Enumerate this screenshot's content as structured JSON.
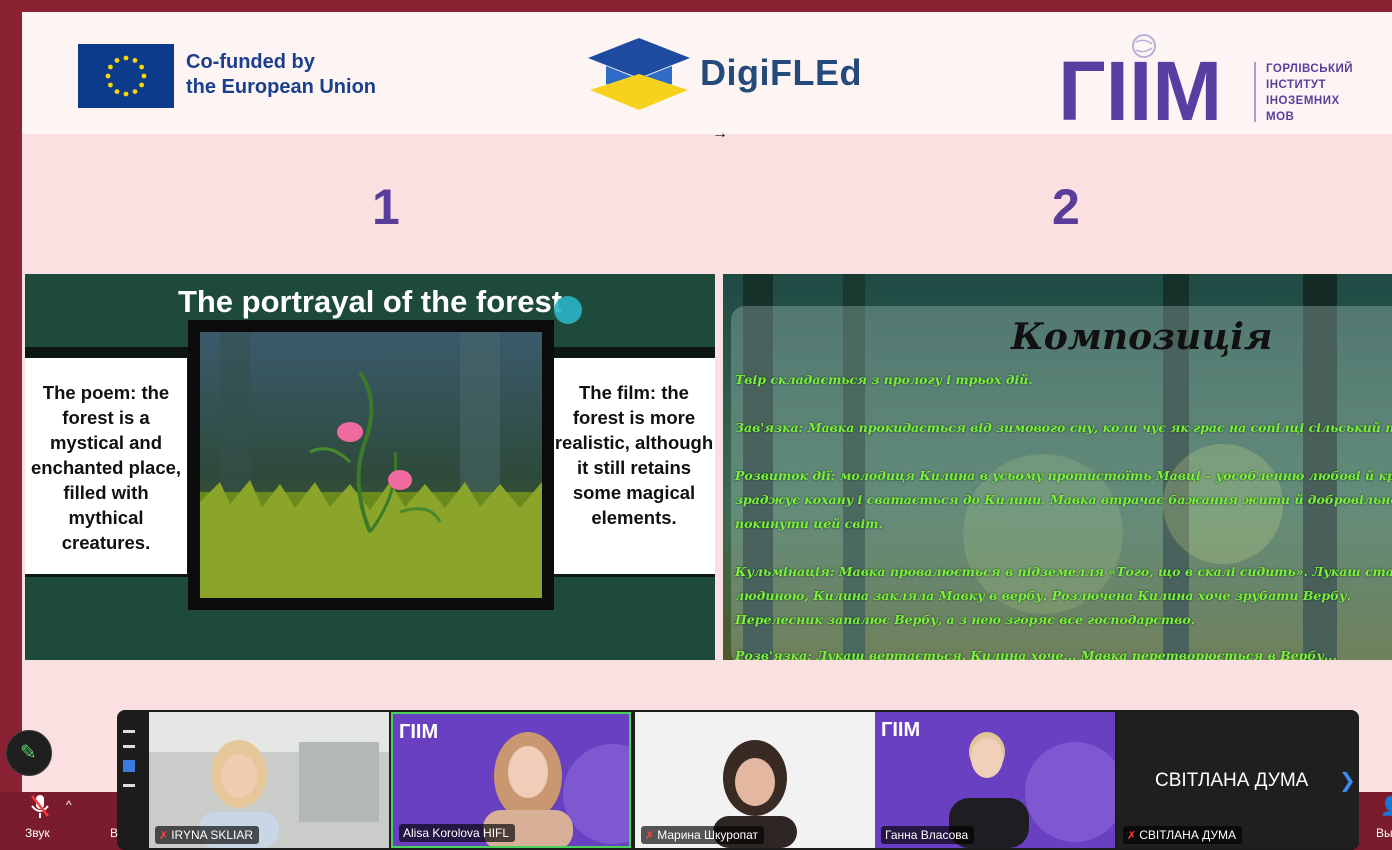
{
  "slide": {
    "eu_text_line1": "Co-funded by",
    "eu_text_line2": "the European Union",
    "digifled_name": "DigiFLEd",
    "giim_logo_letters": "ГІІМ",
    "giim_text_lines": [
      "ГОРЛІВСЬКИЙ",
      "ІНСТИТУТ",
      "ІНОЗЕМНИХ",
      "МОВ"
    ],
    "number_1": "1",
    "number_2": "2",
    "panel1": {
      "title": "The portrayal of the forest",
      "left_text": "The poem: the forest is a mystical and enchanted place, filled with mythical creatures.",
      "right_text": "The film: the forest is more realistic, although it still retains some magical elements."
    },
    "panel2": {
      "title": "Композиція",
      "lines": [
        "Твір складається з прологу і трьох дій.",
        "Зав'язка: Мавка прокидається від зимового сну, коли чує як грає на сопілці сільський парубок",
        "Розвиток дії: молодиця Килина в усьому протистоїть Мавці – уособленню любові й краси,",
        "зраджує кохану і сватається до Килини. Мавка втрачає бажання жити й добровільно",
        "покинути цей світ.",
        "Кульмінація: Мавка провалюється в підземелля «Того, що в скалі сидить». Лукаш стає",
        "людиною, Килина закляла Мавку в вербу. Розлючена Килина хоче зрубати Вербу.",
        "Перелесник запалює Вербу, а з нею згоряє все господарство.",
        "Розв'язка: Лукаш вертається. Килина хоче... Мавка перетворюється в Вербу..."
      ]
    }
  },
  "participants": [
    {
      "name": "IRYNA SKLIAR",
      "muted": true
    },
    {
      "name": "Alisa Korolova HIFL",
      "muted": false
    },
    {
      "name": "Марина Шкуропат",
      "muted": true
    },
    {
      "name": "Ганна Власова",
      "muted": false
    },
    {
      "name": "СВІТЛАНА ДУМА",
      "muted": true
    }
  ],
  "participant5_display_name": "СВІТЛАНА ДУМА",
  "toolbar": {
    "sound_label": "Звук",
    "left_cut_label": "В",
    "right_cut_label": "Вы"
  },
  "colors": {
    "frame": "#7a1c2c",
    "slide_bg": "#fbe0e2",
    "accent_purple": "#5a3d9a",
    "forest_green": "#1e4a3b",
    "active_speaker": "#49d35a"
  }
}
